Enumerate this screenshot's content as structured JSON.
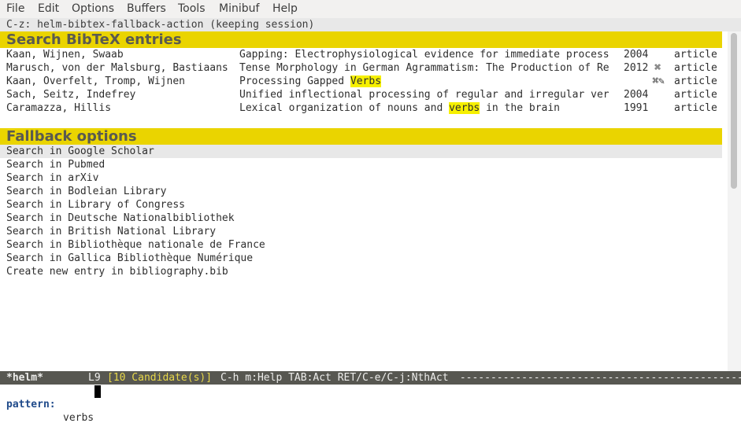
{
  "menubar": {
    "items": [
      "File",
      "Edit",
      "Options",
      "Buffers",
      "Tools",
      "Minibuf",
      "Help"
    ]
  },
  "header_line": "C-z: helm-bibtex-fallback-action (keeping session)",
  "bibtex_source": {
    "title": "Search BibTeX entries",
    "entries": [
      {
        "author": "Kaan, Wijnen, Swaab",
        "title": "Gapping: Electrophysiological evidence for immediate process",
        "year": "2004",
        "type": "article"
      },
      {
        "author": "Marusch, von der Malsburg, Bastiaans",
        "title": "Tense Morphology in German Agrammatism: The Production of Re",
        "year": "2012 ⌘",
        "type": "article"
      },
      {
        "author": "Kaan, Overfelt, Tromp, Wijnen",
        "title_pre": "Processing Gapped ",
        "title_match": "Verbs",
        "year": "⌘✎",
        "type": "article"
      },
      {
        "author": "Sach, Seitz, Indefrey",
        "title": "Unified inflectional processing of regular and irregular ver",
        "year": "2004",
        "type": "article"
      },
      {
        "author": "Caramazza, Hillis",
        "title_pre": "Lexical organization of nouns and ",
        "title_match": "verbs",
        "title_post": " in the brain",
        "year": "1991",
        "type": "article"
      }
    ]
  },
  "fallback_source": {
    "title": "Fallback options",
    "items": [
      "Search in Google Scholar",
      "Search in Pubmed",
      "Search in arXiv",
      "Search in Bodleian Library",
      "Search in Library of Congress",
      "Search in Deutsche Nationalbibliothek",
      "Search in British National Library",
      "Search in Bibliothèque nationale de France",
      "Search in Gallica Bibliothèque Numérique",
      "Create new entry in bibliography.bib"
    ]
  },
  "modeline": {
    "buffer": "*helm*",
    "line": "L9",
    "candidates": "[10 Candidate(s)]",
    "help": "C-h m:Help TAB:Act RET/C-e/C-j:NthAct",
    "dashes": " -----------------------------------------------------"
  },
  "minibuffer": {
    "prompt": "pattern:",
    "value": "verbs"
  },
  "colors": {
    "source_header_bg": "#ead400",
    "match_highlight": "#f6f000",
    "modeline_bg": "#575751",
    "selected_row_bg": "#e8e8e8"
  }
}
